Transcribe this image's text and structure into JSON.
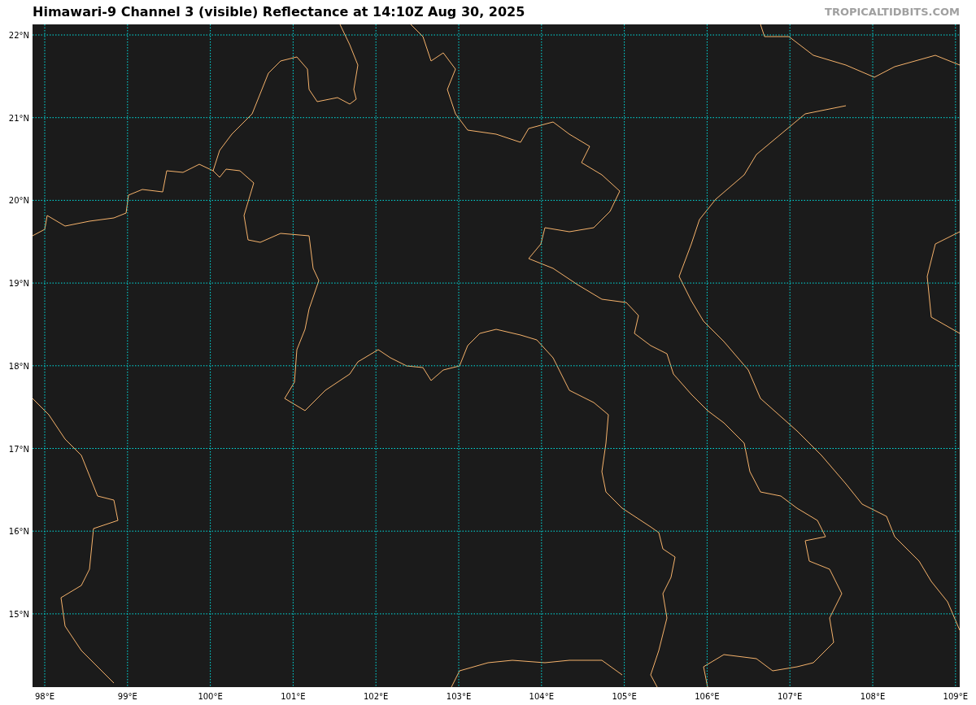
{
  "title": "Himawari-9 Channel 3 (visible) Reflectance at 14:10Z Aug 30, 2025",
  "credit": "TROPICALTIDBITS.COM",
  "map": {
    "lon_labels": [
      "98°E",
      "99°E",
      "100°E",
      "101°E",
      "102°E",
      "103°E",
      "104°E",
      "105°E",
      "106°E",
      "107°E",
      "108°E",
      "109°E"
    ],
    "lat_labels": [
      "22°N",
      "21°N",
      "20°N",
      "19°N",
      "18°N",
      "17°N",
      "16°N",
      "15°N"
    ]
  }
}
